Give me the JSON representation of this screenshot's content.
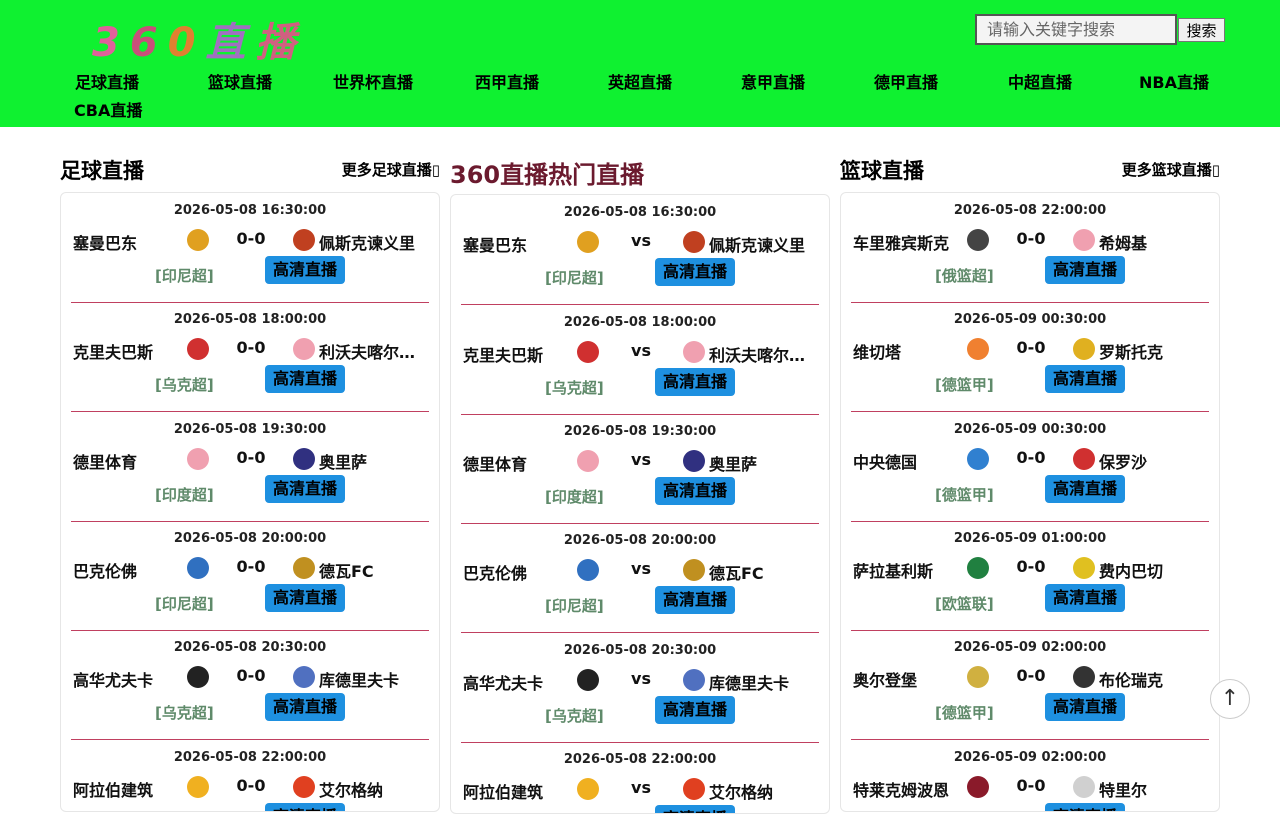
{
  "logo": {
    "chars": [
      "3",
      "6",
      "0",
      "直",
      "播"
    ]
  },
  "search": {
    "placeholder": "请输入关键字搜索",
    "button": "搜索"
  },
  "nav": [
    "足球直播",
    "篮球直播",
    "世界杯直播",
    "西甲直播",
    "英超直播",
    "意甲直播",
    "德甲直播",
    "中超直播",
    "NBA直播",
    "CBA直播"
  ],
  "columns": [
    {
      "title": "足球直播",
      "more": "更多足球直播",
      "vs_text": "",
      "matches": [
        {
          "time": "2026-05-08 16:30:00",
          "home": "塞曼巴东",
          "score": "0-0",
          "away": "佩斯克谏义里",
          "league": "[印尼超]",
          "button": "高清直播",
          "home_color": "#e0a020",
          "away_color": "#c04020"
        },
        {
          "time": "2026-05-08 18:00:00",
          "home": "克里夫巴斯",
          "score": "0-0",
          "away": "利沃夫喀尔巴阡",
          "league": "[乌克超]",
          "button": "高清直播",
          "home_color": "#d03030",
          "away_color": "#f0a0b0"
        },
        {
          "time": "2026-05-08 19:30:00",
          "home": "德里体育",
          "score": "0-0",
          "away": "奥里萨",
          "league": "[印度超]",
          "button": "高清直播",
          "home_color": "#f0a0b0",
          "away_color": "#303080"
        },
        {
          "time": "2026-05-08 20:00:00",
          "home": "巴克伦佛",
          "score": "0-0",
          "away": "德瓦FC",
          "league": "[印尼超]",
          "button": "高清直播",
          "home_color": "#3070c0",
          "away_color": "#c09020"
        },
        {
          "time": "2026-05-08 20:30:00",
          "home": "高华尤夫卡",
          "score": "0-0",
          "away": "库德里夫卡",
          "league": "[乌克超]",
          "button": "高清直播",
          "home_color": "#222222",
          "away_color": "#5070c0"
        },
        {
          "time": "2026-05-08 22:00:00",
          "home": "阿拉伯建筑",
          "score": "0-0",
          "away": "艾尔格纳",
          "league": "",
          "button": "高清直播",
          "home_color": "#f0b020",
          "away_color": "#e04020"
        }
      ]
    },
    {
      "title": "360直播热门直播",
      "more": "",
      "vs_text": "vs",
      "matches": [
        {
          "time": "2026-05-08 16:30:00",
          "home": "塞曼巴东",
          "score": "vs",
          "away": "佩斯克谏义里",
          "league": "[印尼超]",
          "button": "高清直播",
          "home_color": "#e0a020",
          "away_color": "#c04020"
        },
        {
          "time": "2026-05-08 18:00:00",
          "home": "克里夫巴斯",
          "score": "vs",
          "away": "利沃夫喀尔巴阡",
          "league": "[乌克超]",
          "button": "高清直播",
          "home_color": "#d03030",
          "away_color": "#f0a0b0"
        },
        {
          "time": "2026-05-08 19:30:00",
          "home": "德里体育",
          "score": "vs",
          "away": "奥里萨",
          "league": "[印度超]",
          "button": "高清直播",
          "home_color": "#f0a0b0",
          "away_color": "#303080"
        },
        {
          "time": "2026-05-08 20:00:00",
          "home": "巴克伦佛",
          "score": "vs",
          "away": "德瓦FC",
          "league": "[印尼超]",
          "button": "高清直播",
          "home_color": "#3070c0",
          "away_color": "#c09020"
        },
        {
          "time": "2026-05-08 20:30:00",
          "home": "高华尤夫卡",
          "score": "vs",
          "away": "库德里夫卡",
          "league": "[乌克超]",
          "button": "高清直播",
          "home_color": "#222222",
          "away_color": "#5070c0"
        },
        {
          "time": "2026-05-08 22:00:00",
          "home": "阿拉伯建筑",
          "score": "vs",
          "away": "艾尔格纳",
          "league": "",
          "button": "高清直播",
          "home_color": "#f0b020",
          "away_color": "#e04020"
        }
      ]
    },
    {
      "title": "篮球直播",
      "more": "更多篮球直播",
      "vs_text": "",
      "matches": [
        {
          "time": "2026-05-08 22:00:00",
          "home": "车里雅宾斯克",
          "score": "0-0",
          "away": "希姆基",
          "league": "[俄篮超]",
          "button": "高清直播",
          "home_color": "#444444",
          "away_color": "#f0a0b0"
        },
        {
          "time": "2026-05-09 00:30:00",
          "home": "维切塔",
          "score": "0-0",
          "away": "罗斯托克",
          "league": "[德篮甲]",
          "button": "高清直播",
          "home_color": "#f08030",
          "away_color": "#e0b020"
        },
        {
          "time": "2026-05-09 00:30:00",
          "home": "中央德国",
          "score": "0-0",
          "away": "保罗沙",
          "league": "[德篮甲]",
          "button": "高清直播",
          "home_color": "#3080d0",
          "away_color": "#d03030"
        },
        {
          "time": "2026-05-09 01:00:00",
          "home": "萨拉基利斯",
          "score": "0-0",
          "away": "费内巴切",
          "league": "[欧篮联]",
          "button": "高清直播",
          "home_color": "#208040",
          "away_color": "#e0c020"
        },
        {
          "time": "2026-05-09 02:00:00",
          "home": "奥尔登堡",
          "score": "0-0",
          "away": "布伦瑞克",
          "league": "[德篮甲]",
          "button": "高清直播",
          "home_color": "#d0b040",
          "away_color": "#333333"
        },
        {
          "time": "2026-05-09 02:00:00",
          "home": "特莱克姆波恩",
          "score": "0-0",
          "away": "特里尔",
          "league": "",
          "button": "高清直播",
          "home_color": "#8a1a2a",
          "away_color": "#d0d0d0"
        }
      ]
    }
  ],
  "to_top": "↑"
}
